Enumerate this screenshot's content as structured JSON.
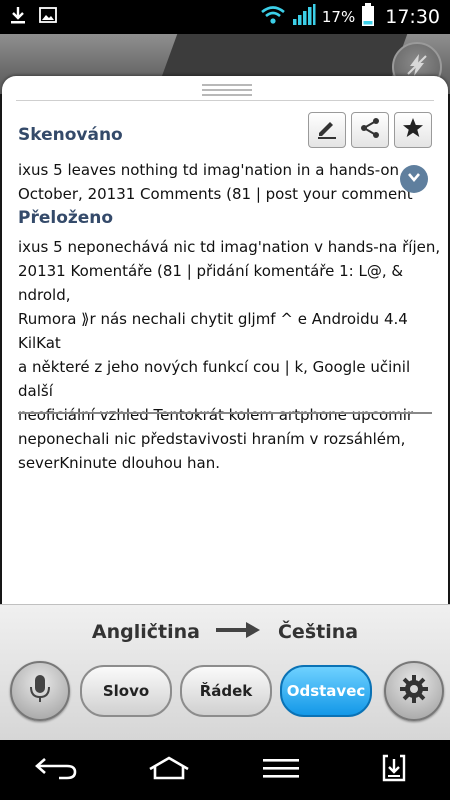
{
  "status_bar": {
    "battery_percent": "17%",
    "time": "17:30",
    "left_icons": [
      "download-icon",
      "image-icon"
    ],
    "right_icons": [
      "wifi-icon",
      "signal-icon",
      "battery-icon"
    ]
  },
  "panel": {
    "scanned_title": "Skenováno",
    "scanned_lines": [
      "ixus 5 leaves nothing td imag'nation in a hands-on",
      "October, 20131 Comments (81 | post your comment"
    ],
    "translated_title": "Přeloženo",
    "translated_lines": [
      "ixus 5 neponechává nic td imag'nation v hands-na říjen,",
      "20131 Komentáře (81 | přidání komentáře 1: L@, & ndrold,",
      "Rumora ⟫r nás nechali chytit gljmf ^ e Androidu 4.4 KilKat",
      "a některé z jeho nových funkcí cou | k, Google učinil další",
      "neoficiální vzhled Tentokrát kolem artphone upcomir",
      "neponechali nic představivosti hraním v rozsáhlém,",
      "severKninute dlouhou han."
    ],
    "action_icons": [
      "edit-icon",
      "share-icon",
      "star-icon"
    ]
  },
  "controls": {
    "source_lang": "Angličtina",
    "target_lang": "Čeština",
    "modes": [
      "Slovo",
      "Řádek",
      "Odstavec"
    ],
    "active_mode": "Odstavec",
    "accent_color": "#1a9ff0"
  },
  "navbar": {
    "icons": [
      "back-icon",
      "home-icon",
      "menu-icon",
      "save-icon"
    ]
  }
}
